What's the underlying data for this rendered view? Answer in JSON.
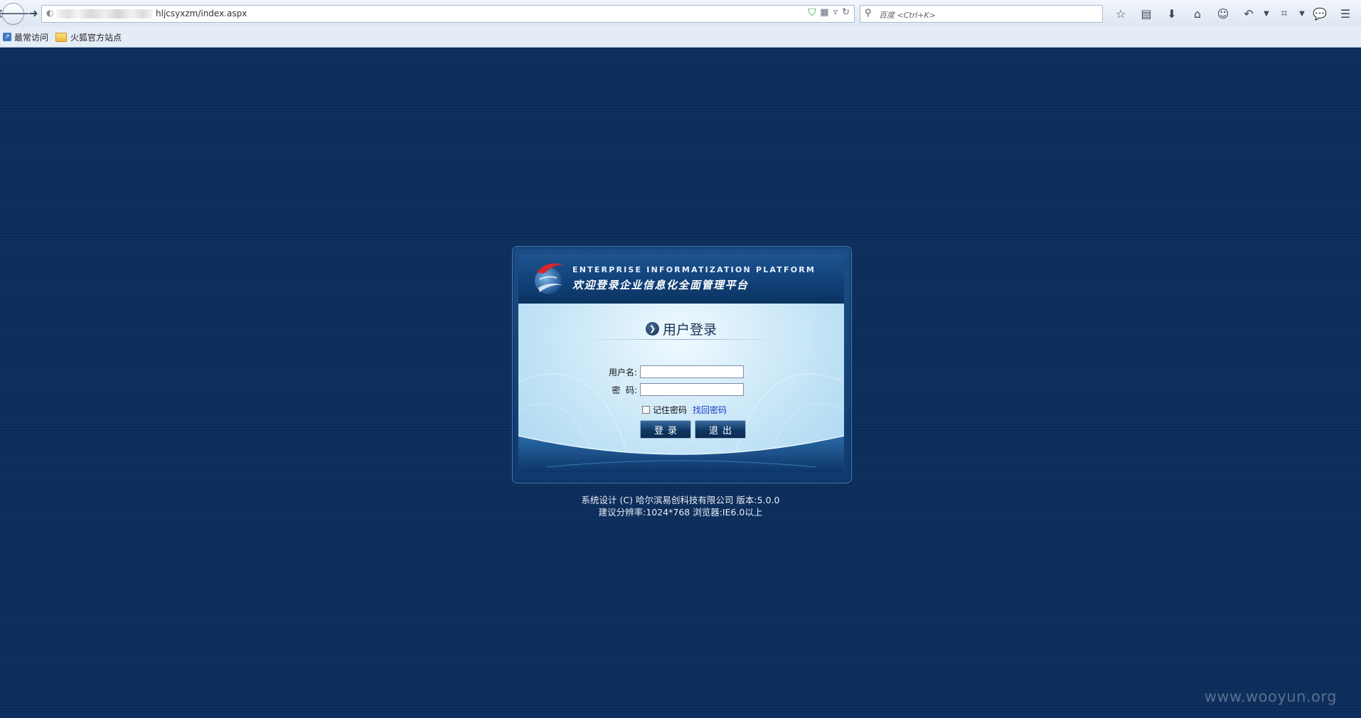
{
  "browser": {
    "url_text": "hljcsyxzm/index.aspx",
    "search_placeholder": "百度 <Ctrl+K>",
    "bookmarks": [
      {
        "label": "最常访问"
      },
      {
        "label": "火狐官方站点"
      }
    ]
  },
  "login": {
    "banner_en": "ENTERPRISE INFORMATIZATION PLATFORM",
    "banner_cn": "欢迎登录企业信息化全面管理平台",
    "title": "用户登录",
    "username_label": "用户名:",
    "password_label": "密  码:",
    "username_value": "",
    "password_value": "",
    "remember_label": "记住密码",
    "forgot_label": "找回密码",
    "login_button": "登录",
    "exit_button": "退出"
  },
  "footer": {
    "line1": "系统设计 (C) 哈尔滨易创科技有限公司 版本:5.0.0",
    "line2": "建议分辨率:1024*768  浏览器:IE6.0以上"
  },
  "watermark": "www.wooyun.org",
  "colors": {
    "page_bg": "#0e2f5c",
    "banner_bg": "#103f76",
    "form_bg": "#cde9f8",
    "link": "#1a3ec8"
  }
}
